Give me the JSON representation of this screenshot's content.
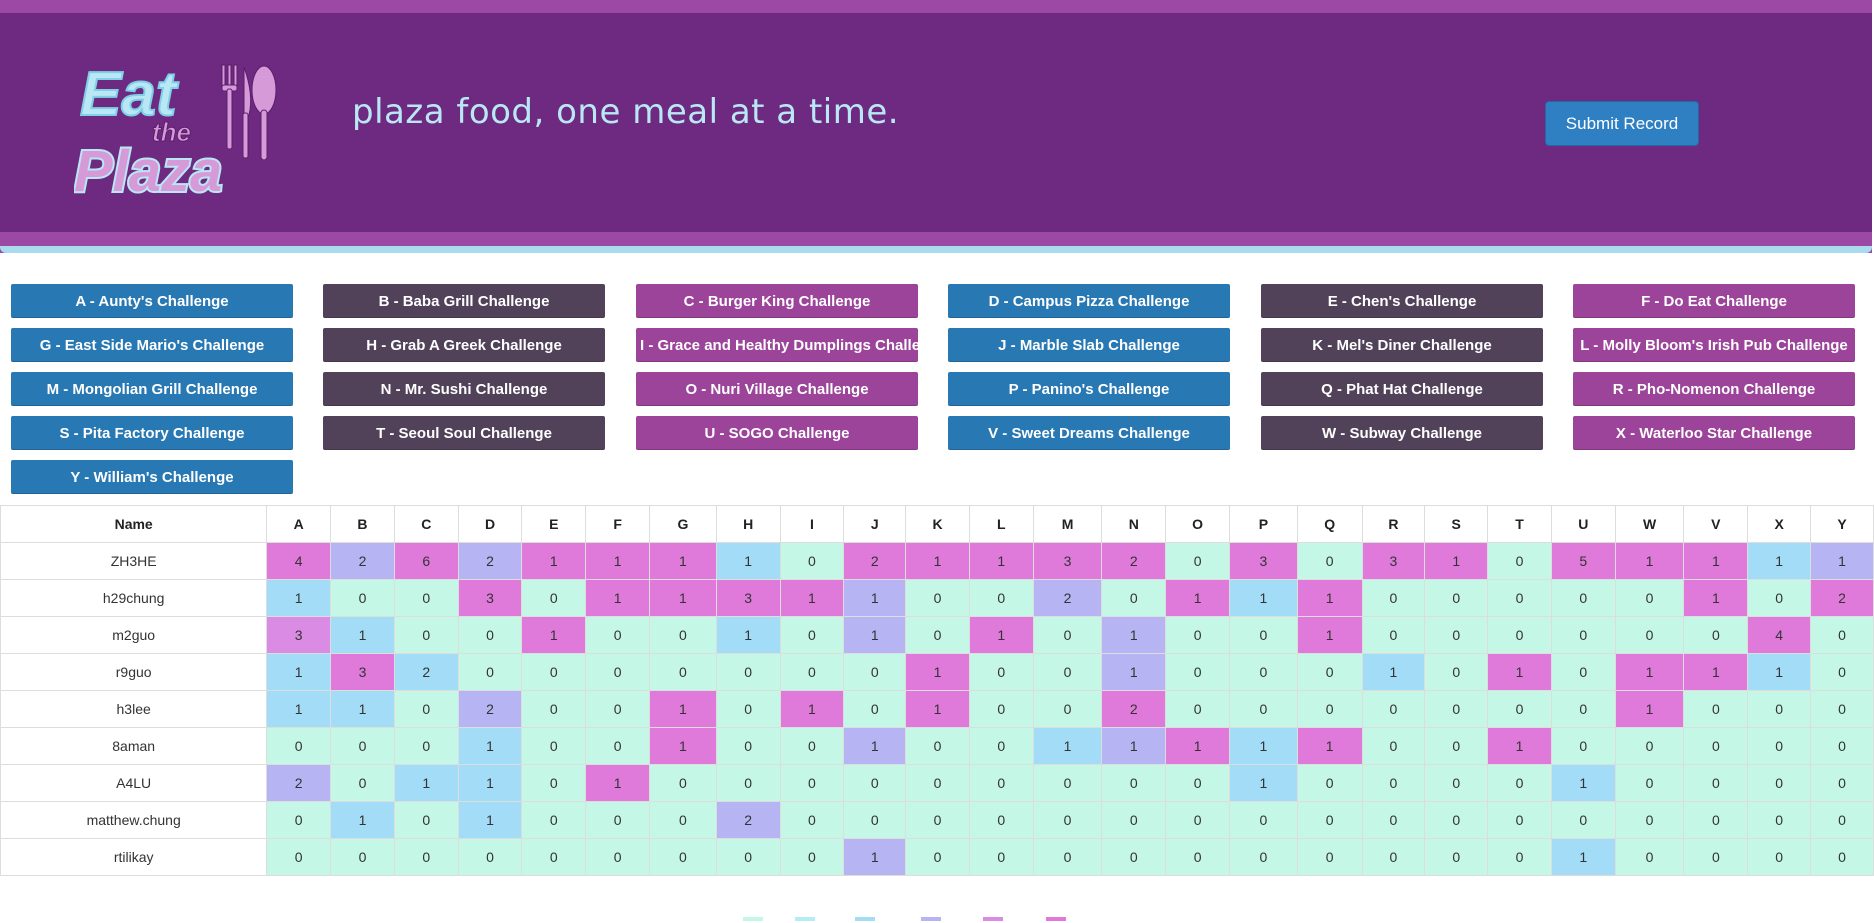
{
  "header": {
    "logo_text": "Eat the Plaza",
    "tagline": "plaza food, one meal at a time.",
    "submit_label": "Submit Record"
  },
  "colors": {
    "header_purple": "#6e2a80",
    "header_border": "#9b49a4",
    "accent_cyan": "#b9e8f4",
    "btn_blue": "#2878b4",
    "btn_dark": "#51425a",
    "btn_magenta": "#9b4499",
    "score_scale": [
      "#c5f7e6",
      "#a3dcf7",
      "#b6b4f3",
      "#da8be4",
      "#e07ada"
    ]
  },
  "challenges": [
    "A - Aunty's Challenge",
    "B - Baba Grill Challenge",
    "C - Burger King Challenge",
    "D - Campus Pizza Challenge",
    "E - Chen's Challenge",
    "F - Do Eat Challenge",
    "G - East Side Mario's Challenge",
    "H - Grab A Greek Challenge",
    "I - Grace and Healthy Dumplings Challenge",
    "J - Marble Slab Challenge",
    "K - Mel's Diner Challenge",
    "L - Molly Bloom's Irish Pub Challenge",
    "M - Mongolian Grill Challenge",
    "N - Mr. Sushi Challenge",
    "O - Nuri Village Challenge",
    "P - Panino's Challenge",
    "Q - Phat Hat Challenge",
    "R - Pho-Nomenon Challenge",
    "S - Pita Factory Challenge",
    "T - Seoul Soul Challenge",
    "U - SOGO Challenge",
    "V - Sweet Dreams Challenge",
    "W - Subway Challenge",
    "X - Waterloo Star Challenge",
    "Y - William's Challenge"
  ],
  "table": {
    "name_header": "Name",
    "columns": [
      "A",
      "B",
      "C",
      "D",
      "E",
      "F",
      "G",
      "H",
      "I",
      "J",
      "K",
      "L",
      "M",
      "N",
      "O",
      "P",
      "Q",
      "R",
      "S",
      "T",
      "U",
      "W",
      "V",
      "X",
      "Y"
    ],
    "rows": [
      {
        "name": "ZH3HE",
        "values": [
          4,
          2,
          6,
          2,
          1,
          1,
          1,
          1,
          0,
          2,
          1,
          1,
          3,
          2,
          0,
          3,
          0,
          3,
          1,
          0,
          5,
          1,
          1,
          1,
          1
        ]
      },
      {
        "name": "h29chung",
        "values": [
          1,
          0,
          0,
          3,
          0,
          1,
          1,
          3,
          1,
          1,
          0,
          0,
          2,
          0,
          1,
          1,
          1,
          0,
          0,
          0,
          0,
          0,
          1,
          0,
          2
        ]
      },
      {
        "name": "m2guo",
        "values": [
          3,
          1,
          0,
          0,
          1,
          0,
          0,
          1,
          0,
          1,
          0,
          1,
          0,
          1,
          0,
          0,
          1,
          0,
          0,
          0,
          0,
          0,
          0,
          4,
          0
        ]
      },
      {
        "name": "r9guo",
        "values": [
          1,
          3,
          2,
          0,
          0,
          0,
          0,
          0,
          0,
          0,
          1,
          0,
          0,
          1,
          0,
          0,
          0,
          1,
          0,
          1,
          0,
          1,
          1,
          1,
          0
        ]
      },
      {
        "name": "h3lee",
        "values": [
          1,
          1,
          0,
          2,
          0,
          0,
          1,
          0,
          1,
          0,
          1,
          0,
          0,
          2,
          0,
          0,
          0,
          0,
          0,
          0,
          0,
          1,
          0,
          0,
          0
        ]
      },
      {
        "name": "8aman",
        "values": [
          0,
          0,
          0,
          1,
          0,
          0,
          1,
          0,
          0,
          1,
          0,
          0,
          1,
          1,
          1,
          1,
          1,
          0,
          0,
          1,
          0,
          0,
          0,
          0,
          0
        ]
      },
      {
        "name": "A4LU",
        "values": [
          2,
          0,
          1,
          1,
          0,
          1,
          0,
          0,
          0,
          0,
          0,
          0,
          0,
          0,
          0,
          1,
          0,
          0,
          0,
          0,
          1,
          0,
          0,
          0,
          0
        ]
      },
      {
        "name": "matthew.chung",
        "values": [
          0,
          1,
          0,
          1,
          0,
          0,
          0,
          2,
          0,
          0,
          0,
          0,
          0,
          0,
          0,
          0,
          0,
          0,
          0,
          0,
          0,
          0,
          0,
          0,
          0
        ]
      },
      {
        "name": "rtilikay",
        "values": [
          0,
          0,
          0,
          0,
          0,
          0,
          0,
          0,
          0,
          1,
          0,
          0,
          0,
          0,
          0,
          0,
          0,
          0,
          0,
          0,
          1,
          0,
          0,
          0,
          0
        ]
      }
    ],
    "cell_colors": [
      [
        4,
        2,
        4,
        2,
        4,
        4,
        4,
        1,
        0,
        4,
        4,
        4,
        4,
        4,
        0,
        4,
        0,
        4,
        4,
        0,
        4,
        4,
        4,
        1,
        2
      ],
      [
        1,
        0,
        0,
        4,
        0,
        4,
        4,
        4,
        4,
        2,
        0,
        0,
        2,
        0,
        4,
        1,
        4,
        0,
        0,
        0,
        0,
        0,
        4,
        0,
        4
      ],
      [
        3,
        1,
        0,
        0,
        4,
        0,
        0,
        1,
        0,
        2,
        0,
        4,
        0,
        2,
        0,
        0,
        4,
        0,
        0,
        0,
        0,
        0,
        0,
        4,
        0
      ],
      [
        1,
        4,
        1,
        0,
        0,
        0,
        0,
        0,
        0,
        0,
        4,
        0,
        0,
        2,
        0,
        0,
        0,
        1,
        0,
        4,
        0,
        4,
        4,
        1,
        0
      ],
      [
        1,
        1,
        0,
        2,
        0,
        0,
        4,
        0,
        4,
        0,
        4,
        0,
        0,
        4,
        0,
        0,
        0,
        0,
        0,
        0,
        0,
        4,
        0,
        0,
        0
      ],
      [
        0,
        0,
        0,
        1,
        0,
        0,
        4,
        0,
        0,
        2,
        0,
        0,
        1,
        2,
        4,
        1,
        4,
        0,
        0,
        4,
        0,
        0,
        0,
        0,
        0
      ],
      [
        2,
        0,
        1,
        1,
        0,
        4,
        0,
        0,
        0,
        0,
        0,
        0,
        0,
        0,
        0,
        1,
        0,
        0,
        0,
        0,
        1,
        0,
        0,
        0,
        0
      ],
      [
        0,
        1,
        0,
        1,
        0,
        0,
        0,
        2,
        0,
        0,
        0,
        0,
        0,
        0,
        0,
        0,
        0,
        0,
        0,
        0,
        0,
        0,
        0,
        0,
        0
      ],
      [
        0,
        0,
        0,
        0,
        0,
        0,
        0,
        0,
        0,
        2,
        0,
        0,
        0,
        0,
        0,
        0,
        0,
        0,
        0,
        0,
        1,
        0,
        0,
        0,
        0
      ]
    ]
  }
}
